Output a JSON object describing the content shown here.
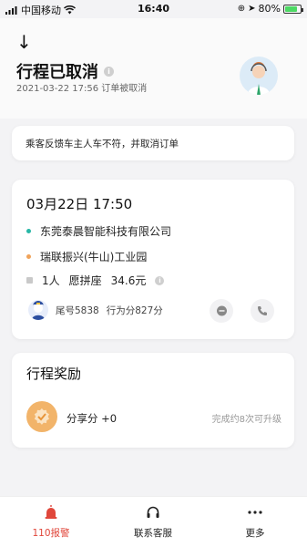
{
  "status_bar": {
    "carrier": "中国移动",
    "time": "16:40",
    "battery": "80%",
    "battery_level": 0.8
  },
  "header": {
    "title": "行程已取消",
    "subtitle": "2021-03-22 17:56 订单被取消"
  },
  "notice": {
    "text": "乘客反馈车主人车不符，并取消订单"
  },
  "trip": {
    "datetime": "03月22日 17:50",
    "origin": "东莞泰晨智能科技有限公司",
    "destination": "瑞联振兴(牛山)工业园",
    "passengers": "1人",
    "carpool": "愿拼座",
    "price": "34.6元",
    "rider_tail": "尾号5838",
    "rider_score": "行为分827分"
  },
  "reward": {
    "title": "行程奖励",
    "score": "分享分 +0",
    "hint": "完成约8次可升级"
  },
  "tabbar": {
    "items": [
      {
        "label": "110报警"
      },
      {
        "label": "联系客服"
      },
      {
        "label": "更多"
      }
    ]
  },
  "colors": {
    "origin_dot": "#28b7a6",
    "destination_dot": "#f0a35a",
    "alarm": "#e0473b",
    "badge": "#f2b46a"
  }
}
